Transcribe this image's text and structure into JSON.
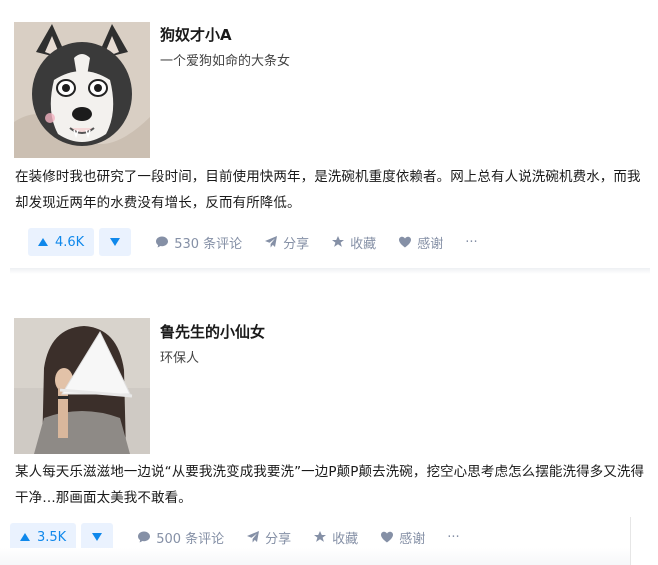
{
  "answers": [
    {
      "author": {
        "name": "狗奴才小A",
        "bio": "一个爱狗如命的大条女"
      },
      "content": "在装修时我也研究了一段时间，目前使用快两年，是洗碗机重度依赖者。网上总有人说洗碗机费水，而我却发现近两年的水费没有增长，反而有所降低。",
      "actions": {
        "upvote": "4.6K",
        "comments": "530 条评论",
        "share": "分享",
        "favorite": "收藏",
        "thanks": "感谢",
        "more": "···"
      }
    },
    {
      "author": {
        "name": "鲁先生的小仙女",
        "bio": "环保人"
      },
      "content": "某人每天乐滋滋地一边说“从要我洗变成我要洗”一边P颠P颠去洗碗，挖空心思考虑怎么摆能洗得多又洗得干净…那画面太美我不敢看。",
      "actions": {
        "upvote": "3.5K",
        "comments": "500 条评论",
        "share": "分享",
        "favorite": "收藏",
        "thanks": "感谢",
        "more": "···"
      }
    }
  ],
  "icons": {
    "comment": "comment-icon",
    "share": "share-icon",
    "favorite": "star-icon",
    "thanks": "heart-icon",
    "upvote": "triangle-up-icon",
    "downvote": "triangle-down-icon"
  },
  "colors": {
    "accent": "#0f88eb",
    "vote_bg": "#eaf2fe",
    "muted": "#8590a6",
    "text": "#1a1a1a"
  }
}
